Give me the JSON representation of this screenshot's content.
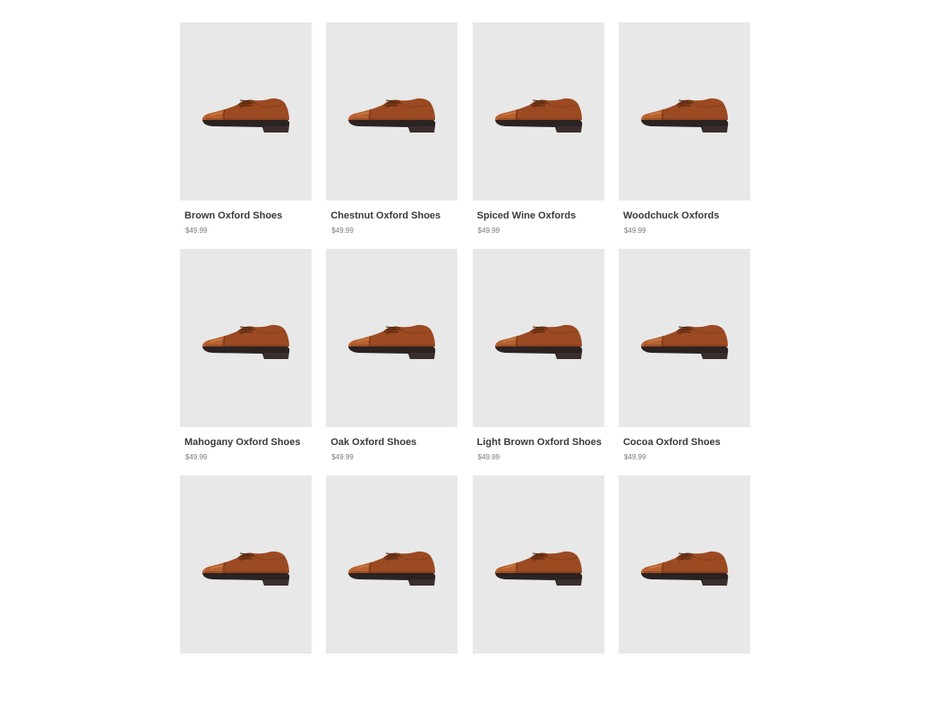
{
  "products": [
    {
      "name": "Brown Oxford Shoes",
      "price": "$49.99"
    },
    {
      "name": "Chestnut Oxford Shoes",
      "price": "$49.99"
    },
    {
      "name": "Spiced Wine Oxfords",
      "price": "$49.99"
    },
    {
      "name": "Woodchuck Oxfords",
      "price": "$49.99"
    },
    {
      "name": "Mahogany Oxford Shoes",
      "price": "$49.99"
    },
    {
      "name": "Oak Oxford Shoes",
      "price": "$49.99"
    },
    {
      "name": "Light Brown Oxford Shoes",
      "price": "$49.99"
    },
    {
      "name": "Cocoa Oxford Shoes",
      "price": "$49.99"
    },
    {
      "name": "",
      "price": ""
    },
    {
      "name": "",
      "price": ""
    },
    {
      "name": "",
      "price": ""
    },
    {
      "name": "",
      "price": ""
    }
  ],
  "colors": {
    "thumb_bg": "#e8e8e8",
    "leather": "#9c4a22",
    "leather_dark": "#6b3015",
    "sole": "#2b2222"
  },
  "icons": {
    "product_image": "oxford-shoe-icon"
  }
}
